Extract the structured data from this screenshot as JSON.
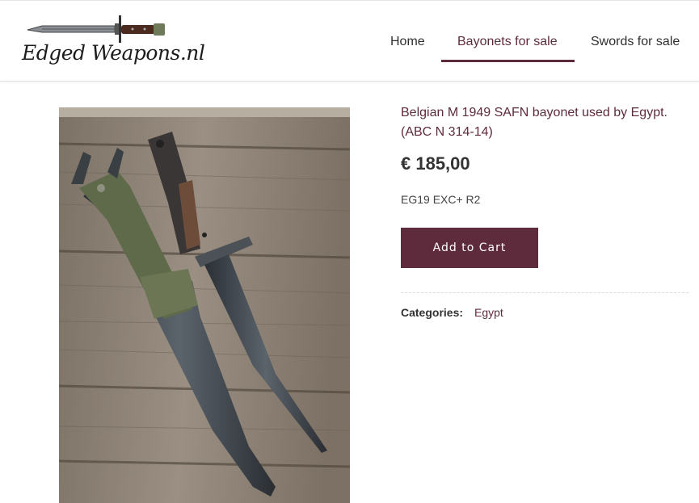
{
  "header": {
    "logo_text": "Edged Weapons.nl",
    "nav": [
      {
        "label": "Home"
      },
      {
        "label": "Bayonets for sale",
        "active": true
      },
      {
        "label": "Swords for sale"
      }
    ]
  },
  "product": {
    "title": "Belgian M 1949 SAFN bayonet used by Egypt. (ABC N 314-14)",
    "price": "€ 185,00",
    "sku": "EG19 EXC+ R2",
    "add_to_cart_label": "Add to Cart",
    "categories_label": "Categories:",
    "category": "Egypt"
  },
  "colors": {
    "accent": "#5e2b3d",
    "text": "#333333"
  }
}
